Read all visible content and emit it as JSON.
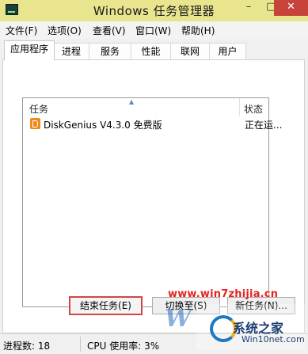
{
  "window": {
    "title": "Windows 任务管理器",
    "controls": {
      "minimize": "–",
      "maximize": "▢",
      "close": "✕"
    }
  },
  "menu": [
    "文件(F)",
    "选项(O)",
    "查看(V)",
    "窗口(W)",
    "帮助(H)"
  ],
  "tabs": [
    {
      "label": "应用程序",
      "active": true
    },
    {
      "label": "进程",
      "active": false
    },
    {
      "label": "服务",
      "active": false
    },
    {
      "label": "性能",
      "active": false
    },
    {
      "label": "联网",
      "active": false
    },
    {
      "label": "用户",
      "active": false
    }
  ],
  "tasklist": {
    "sort_indicator": "▲",
    "columns": {
      "task": "任务",
      "status": "状态"
    },
    "rows": [
      {
        "name": "DiskGenius V4.3.0 免费版",
        "status": "正在运...",
        "icon": "diskgenius-icon"
      }
    ]
  },
  "buttons": {
    "end_task": "结束任务(E)",
    "switch_to": "切换至(S)",
    "new_task": "新任务(N)..."
  },
  "statusbar": {
    "processes": "进程数: 18",
    "cpu": "CPU 使用率: 3%"
  },
  "watermark": {
    "url": "www.win7zhijia.cn",
    "brand": "系统之家",
    "site": "Win10net.com",
    "glyph": "W"
  },
  "colors": {
    "titlebar": "#e8e58e",
    "close_button": "#c6443a",
    "highlight_border": "#d24545"
  }
}
